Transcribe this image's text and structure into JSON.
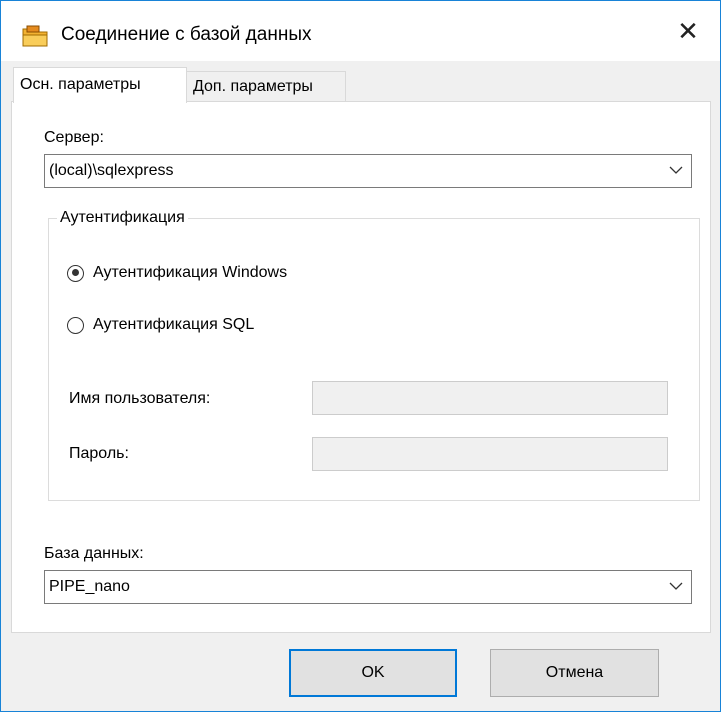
{
  "window": {
    "title": "Соединение с базой данных",
    "close_glyph": "✕"
  },
  "tabs": [
    {
      "label": "Осн. параметры",
      "active": true
    },
    {
      "label": "Доп. параметры",
      "active": false
    }
  ],
  "server": {
    "label": "Сервер:",
    "value": "(local)\\sqlexpress"
  },
  "auth": {
    "legend": "Аутентификация",
    "options": [
      {
        "label": "Аутентификация Windows",
        "selected": true
      },
      {
        "label": "Аутентификация SQL",
        "selected": false
      }
    ],
    "username_label": "Имя пользователя:",
    "username_value": "",
    "password_label": "Пароль:",
    "password_value": ""
  },
  "database": {
    "label": "База данных:",
    "value": "PIPE_nano"
  },
  "buttons": {
    "ok": "OK",
    "cancel": "Отмена"
  },
  "colors": {
    "accent": "#0078d7",
    "window_border": "#1883d7",
    "icon_fill": "#f3b232"
  },
  "icons": {
    "app": "database-folder-icon",
    "close": "close-icon",
    "dropdown": "chevron-down-icon"
  }
}
